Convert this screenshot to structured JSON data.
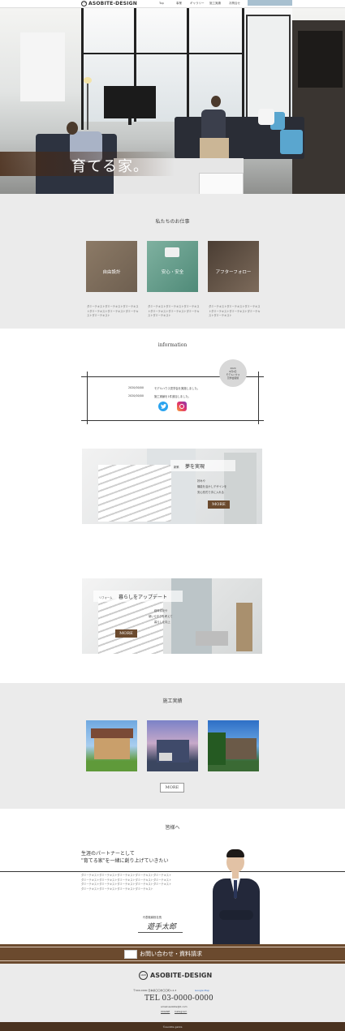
{
  "header": {
    "logo_mark": "ASOB",
    "logo_text": "ASOBITE-DESIGN",
    "nav": [
      "Top",
      "事業",
      "ギャラリー",
      "施工実績",
      "お問合せ"
    ]
  },
  "hero": {
    "title": "育てる家。"
  },
  "works": {
    "title": "私たちのお仕事",
    "cards": [
      {
        "label": "自由設計",
        "desc": "ダミーテキストダミーテキストダミーテキストダミーテキストダミーテキストダミーテキストダミーテキスト"
      },
      {
        "label": "安心・安全",
        "desc": "ダミーテキストダミーテキストダミーテキストダミーテキストダミーテキストダミーテキストダミーテキスト"
      },
      {
        "label": "アフターフォロー",
        "desc": "ダミーテキストダミーテキストダミーテキストダミーテキストダミーテキストダミーテキストダミーテキスト"
      }
    ]
  },
  "information": {
    "title": "information",
    "badge": [
      "2020",
      "8月4日",
      "モデルハウス",
      "見学会開催"
    ],
    "news": [
      {
        "date": "2020/00/00",
        "text": "モデルハウス見学会を実施しました。"
      },
      {
        "date": "2020/00/00",
        "text": "施工実績を1件追加しました。"
      }
    ]
  },
  "feature1": {
    "tag": "新築",
    "title": "夢を実現",
    "lines": [
      "好みや",
      "機能を活かしデザインを",
      "安心形式で手に入れる"
    ],
    "more": "MORE"
  },
  "feature2": {
    "tag": "リフォーム",
    "title": "暮らしをアップデート",
    "lines": [
      "経年劣化や",
      "使いやすさを考えて",
      "暮らしを向上"
    ],
    "more": "MORE"
  },
  "results": {
    "title": "施工実績",
    "more": "MORE"
  },
  "message": {
    "title": "皆様へ",
    "lead1": "生涯のパートナーとして",
    "lead2": "\"育てる家\"を一緒に創り上げていきたい",
    "body": "ダミーテキストダミーテキストダミーテキストダミーテキストダミーテキストダミーテキストダミーテキストダミーテキストダミーテキストダミーテキストダミーテキストダミーテキストダミーテキストダミーテキストダミーテキストダミーテキストダミーテキストダミーテキストダミーテキスト",
    "sign_role": "代表取締役社長",
    "sign_name": "遊手太郎"
  },
  "cta": {
    "label": "お問い合わせ・資料請求"
  },
  "footer": {
    "logo_mark": "ASOB",
    "logo_text": "ASOBITE-DESIGN",
    "address": "〒000-0000 日本県〇〇市〇〇町1-2-3",
    "map_link": "Google Map",
    "tel": "TEL 03-0000-0000",
    "email": "email:asobite@0.com",
    "links": [
      "ONLINE",
      "Instagram"
    ],
    "copyright": "©asobite gakka"
  },
  "colors": {
    "brown": "#6b4a2e",
    "gray_bg": "#ebebeb",
    "hero_band": "#5a3a22"
  }
}
